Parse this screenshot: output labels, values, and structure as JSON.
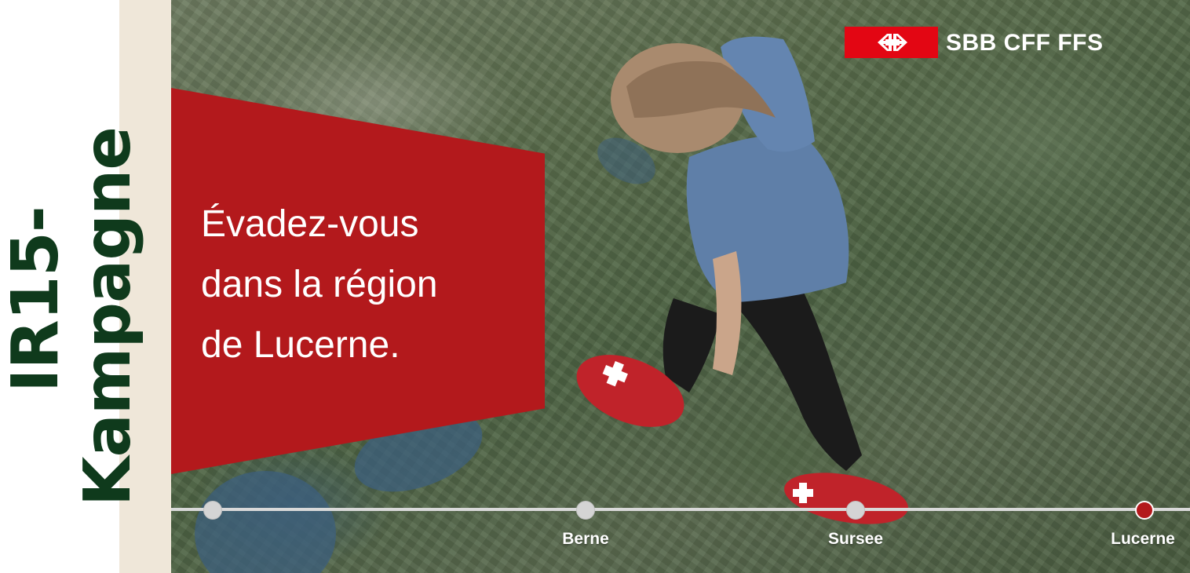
{
  "sidebar": {
    "line1": "IR15-",
    "line2": "Kampagne"
  },
  "banner": {
    "lines": [
      "Évadez-vous",
      "dans la région",
      "de Lucerne."
    ]
  },
  "logo": {
    "text": "SBB CFF FFS",
    "icon": "sbb-arrows-icon",
    "color": "#e30613"
  },
  "timeline": {
    "stops": [
      {
        "label": ""
      },
      {
        "label": "Berne"
      },
      {
        "label": "Sursee"
      },
      {
        "label": "Lucerne",
        "current": true
      }
    ]
  },
  "colors": {
    "accent": "#b3191c",
    "sidebar_text": "#0f3a1c",
    "sidebar_bg": "#efe7d9"
  }
}
